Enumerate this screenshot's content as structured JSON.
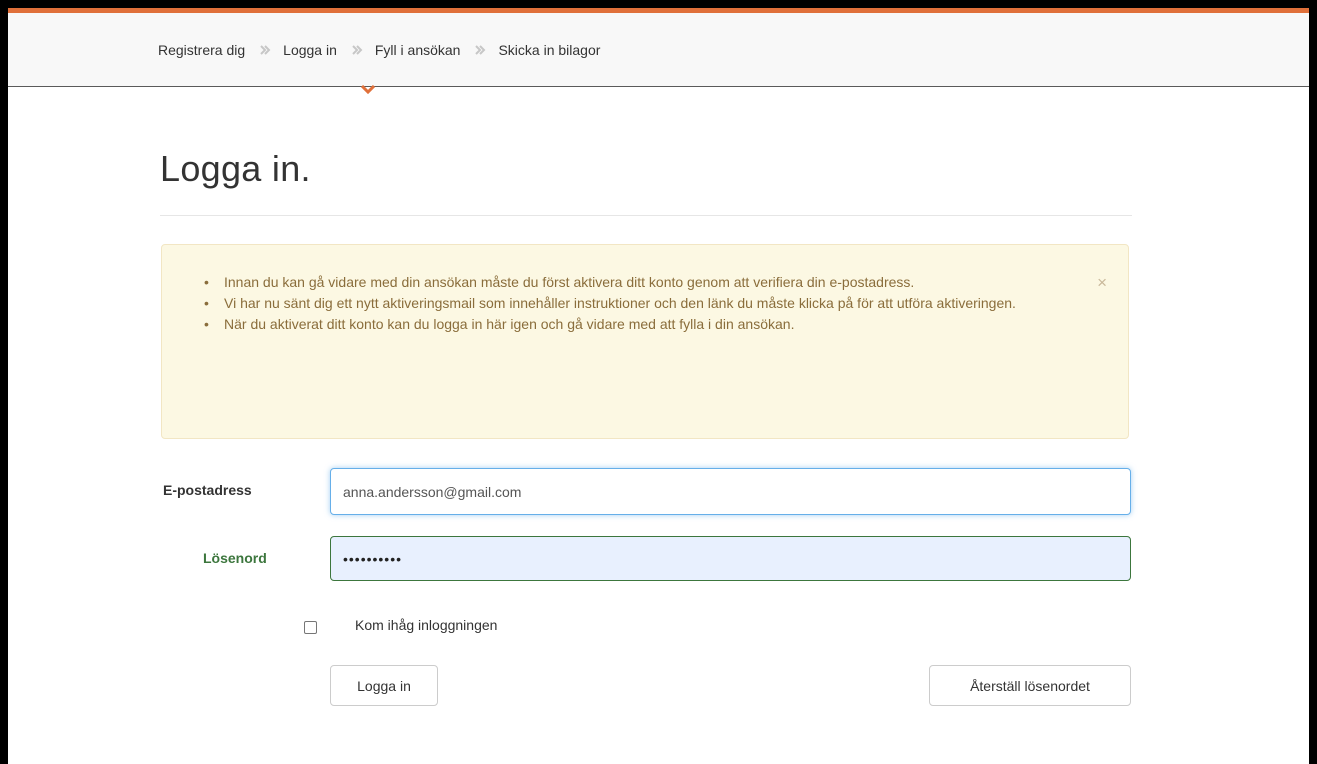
{
  "breadcrumb": {
    "steps": [
      "Registrera dig",
      "Logga in",
      "Fyll i ansökan",
      "Skicka in bilagor"
    ],
    "active_index": 1,
    "separator_icon": "chevron-right-icon",
    "active_marker_icon": "chevron-down-icon"
  },
  "page": {
    "title": "Logga in."
  },
  "alert": {
    "messages": [
      "Innan du kan gå vidare med din ansökan måste du först aktivera ditt konto genom att verifiera din e-postadress.",
      "Vi har nu sänt dig ett nytt aktiveringsmail som innehåller instruktioner och den länk du måste klicka på för att utföra aktiveringen.",
      "När du aktiverat ditt konto kan du logga in här igen och gå vidare med att fylla i din ansökan."
    ],
    "close_symbol": "×"
  },
  "form": {
    "email_label": "E-postadress",
    "email_value": "anna.andersson@gmail.com",
    "password_label": "Lösenord",
    "password_value": "••••••••••",
    "remember_label": "Kom ihåg inloggningen",
    "remember_checked": false,
    "login_button": "Logga in",
    "reset_button": "Återställ lösenordet"
  },
  "colors": {
    "accent": "#e0703a",
    "success": "#3c763d",
    "warning_bg": "#fcf8e3",
    "warning_text": "#8a6d3b"
  }
}
